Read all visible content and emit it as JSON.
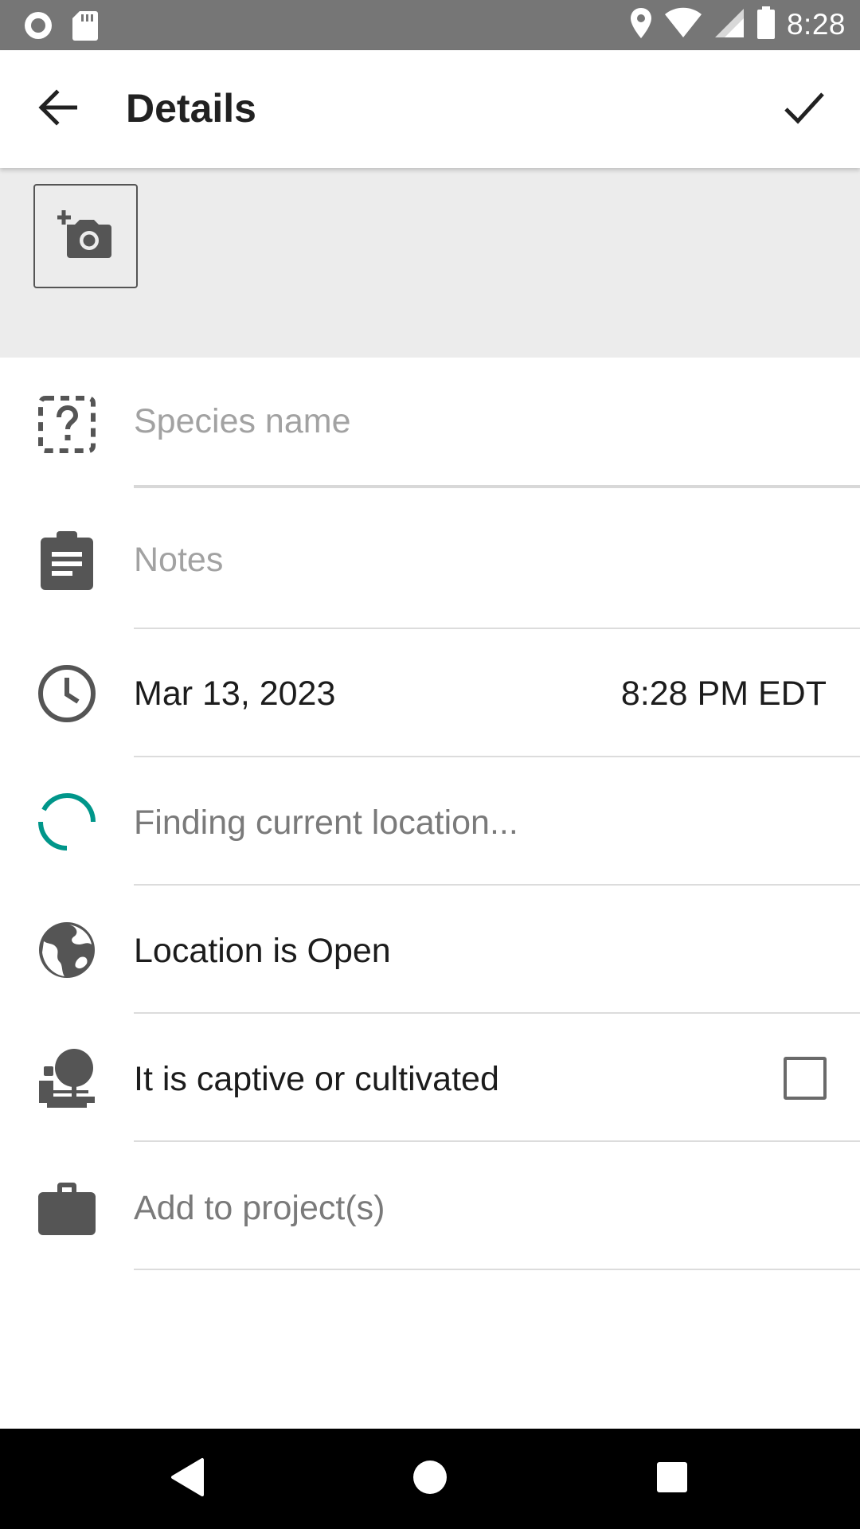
{
  "status_bar": {
    "time": "8:28",
    "left_icons": [
      "record-icon",
      "sd-card-icon"
    ],
    "right_icons": [
      "location-pin-icon",
      "wifi-icon",
      "cell-signal-icon",
      "battery-icon"
    ]
  },
  "app_bar": {
    "title": "Details",
    "back_icon": "arrow-back-icon",
    "save_icon": "check-icon"
  },
  "photo": {
    "add_photo_icon": "add-photo-camera-icon"
  },
  "form": {
    "species_placeholder": "Species name",
    "notes_placeholder": "Notes",
    "date": "Mar 13, 2023",
    "time": "8:28 PM EDT",
    "location_status": "Finding current location...",
    "geoprivacy": "Location is Open",
    "captive_label": "It is captive or cultivated",
    "captive_checked": false,
    "projects_label": "Add to project(s)"
  },
  "colors": {
    "accent": "#00968a",
    "status_bar": "#767676",
    "icon_gray": "#555555",
    "photo_area_bg": "#ececec"
  },
  "nav_bar": {
    "icons": [
      "nav-back-icon",
      "nav-home-icon",
      "nav-recents-icon"
    ]
  }
}
